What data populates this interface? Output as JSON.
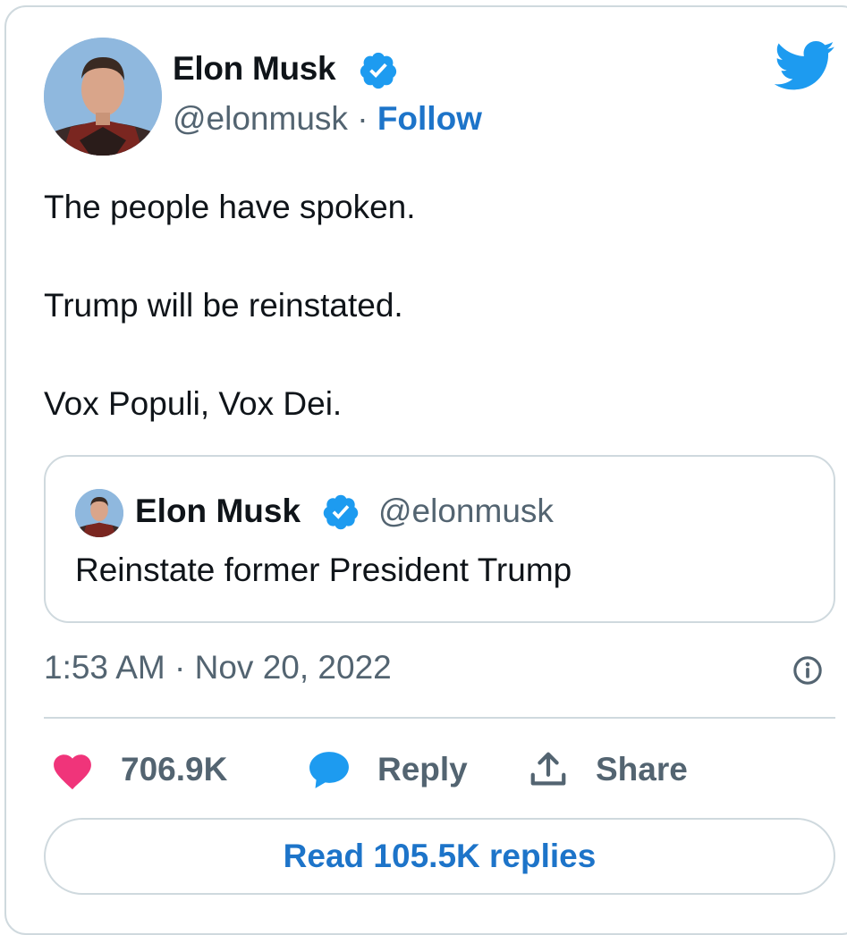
{
  "author": {
    "name": "Elon Musk",
    "handle": "@elonmusk",
    "separator": "·",
    "follow_label": "Follow"
  },
  "tweet": {
    "lines": [
      "The people have spoken.",
      "Trump will be reinstated.",
      "Vox Populi, Vox Dei."
    ]
  },
  "quoted_tweet": {
    "name": "Elon Musk",
    "handle": "@elonmusk",
    "text": "Reinstate former President Trump"
  },
  "timestamp": "1:53 AM · Nov 20, 2022",
  "actions": {
    "likes": "706.9K",
    "reply_label": "Reply",
    "share_label": "Share"
  },
  "read_replies_label": "Read 105.5K replies",
  "icons": [
    "twitter-bird-icon",
    "verified-badge-icon",
    "heart-icon",
    "reply-bubble-icon",
    "share-icon",
    "info-icon"
  ],
  "colors": {
    "accent": "#1d74c9",
    "verified": "#1d9bf0",
    "twitter_blue": "#1d9bf0",
    "heart": "#f0347a",
    "secondary_text": "#536471",
    "border": "#cfd9de"
  }
}
